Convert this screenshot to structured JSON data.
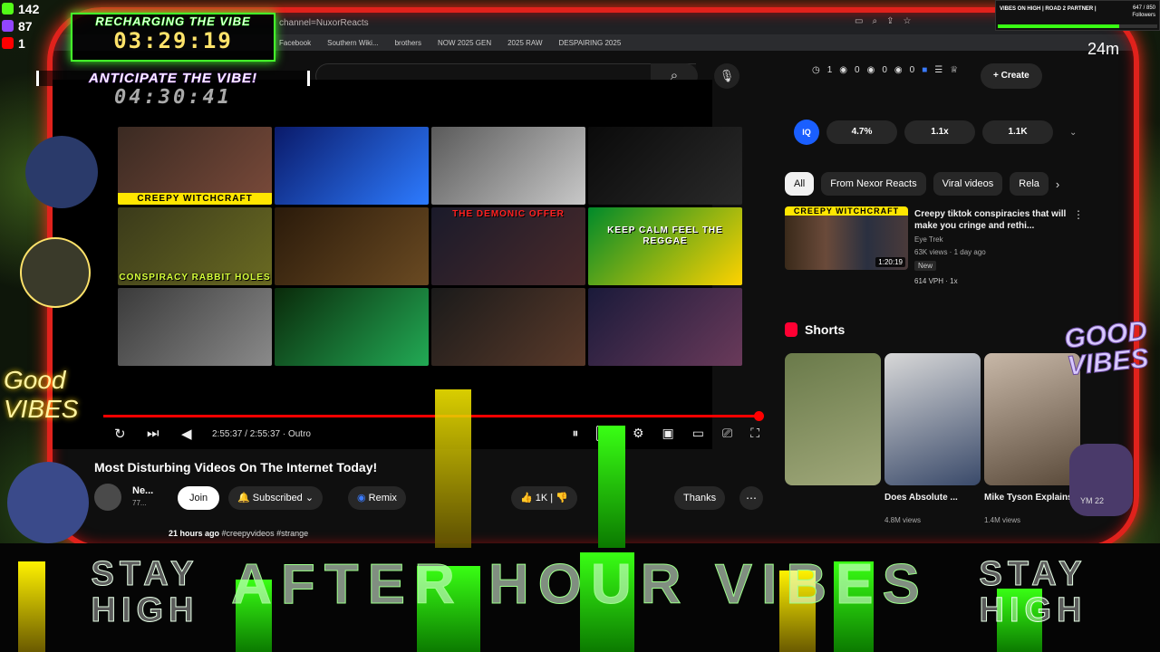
{
  "hud": {
    "kick_count": "142",
    "twitch_count": "87",
    "youtube_count": "1"
  },
  "recharge": {
    "label": "RECHARGING THE VIBE",
    "time": "03:29:19"
  },
  "anticipate": {
    "label": "ANTICIPATE THE VIBE!",
    "time": "04:30:41"
  },
  "goal": {
    "title": "VIBES ON HIGH | ROAD 2 PARTNER |",
    "count": "647 / 850",
    "unit": "Followers",
    "progress": 0.76
  },
  "age_badge": "24m",
  "browser": {
    "address": "channel=NuxorReacts",
    "bookmarks": [
      "Facebook",
      "Southern Wiki...",
      "brothers",
      "NOW 2025 GEN",
      "2025 RAW",
      "DESPAIRING 2025"
    ]
  },
  "topbar": {
    "search_icon": "search-icon",
    "mic_icon": "mic-icon",
    "stats": [
      "1",
      "0",
      "0",
      "0"
    ],
    "create_label": "+ Create"
  },
  "player": {
    "tiles": [
      {
        "caption": "CREEPY WITCHCRAFT",
        "style": "yellow",
        "colors": [
          "#3a2a22",
          "#7a4a3a"
        ]
      },
      {
        "caption": "",
        "style": "",
        "colors": [
          "#0a1a6a",
          "#2d7bff"
        ]
      },
      {
        "caption": "",
        "style": "",
        "colors": [
          "#5a5a5a",
          "#c8c8c8"
        ]
      },
      {
        "caption": "",
        "style": "",
        "colors": [
          "#0a0a0a",
          "#2a2a2a"
        ]
      },
      {
        "caption": "CONSPIRACY RABBIT HOLES",
        "style": "green",
        "colors": [
          "#3a3a1a",
          "#6a6a22"
        ]
      },
      {
        "caption": "",
        "style": "",
        "colors": [
          "#2a1a0a",
          "#6a4a22"
        ]
      },
      {
        "caption": "THE DEMONIC OFFER",
        "style": "red",
        "colors": [
          "#1a1a2a",
          "#4a2a2a"
        ]
      },
      {
        "caption": "KEEP CALM FEEL THE REGGAE",
        "style": "reggae",
        "colors": [
          "#008a2a",
          "#ffd200"
        ]
      },
      {
        "caption": "",
        "style": "",
        "colors": [
          "#3a3a3a",
          "#8a8a8a"
        ]
      },
      {
        "caption": "",
        "style": "",
        "colors": [
          "#0a2a0a",
          "#22aa55"
        ]
      },
      {
        "caption": "",
        "style": "",
        "colors": [
          "#1a1a1a",
          "#5a3a2a"
        ]
      },
      {
        "caption": "",
        "style": "",
        "colors": [
          "#1a1a3a",
          "#6a3a5a"
        ]
      }
    ],
    "time": "2:55:37 / 2:55:37 · Outro",
    "progress": 1.0
  },
  "video": {
    "title": "Most Disturbing Videos On The Internet Today!",
    "channel": "Ne...",
    "subscribers": "77...",
    "join_label": "Join",
    "subscribe_label": "Subscribed",
    "remix_label": "Remix",
    "likes": "1K",
    "thanks_label": "Thanks",
    "age": "21 hours ago",
    "hashtags": "#creepyvideos #strange"
  },
  "sidebar": {
    "iq_label": "IQ",
    "metrics": [
      "4.7%",
      "1.1x",
      "1.1K"
    ],
    "filters": [
      "All",
      "From Nexor Reacts",
      "Viral videos",
      "Rela"
    ],
    "rec": {
      "caption": "CREEPY WITCHCRAFT",
      "duration": "1:20:19",
      "title": "Creepy tiktok conspiracies that will make you cringe and rethi...",
      "channel": "Eye Trek",
      "meta": "63K views · 1 day ago",
      "badge": "New",
      "vph": "614 VPH",
      "multiplier": "1x"
    },
    "shorts_label": "Shorts",
    "shorts": [
      {
        "title": "",
        "views": "",
        "colors": [
          "#6a7a4a",
          "#a0a87a"
        ]
      },
      {
        "title": "Does Absolute ...",
        "views": "4.8M views",
        "colors": [
          "#d8d8d8",
          "#3a4a6a"
        ]
      },
      {
        "title": "Mike Tyson Explains W...",
        "views": "1.4M views",
        "colors": [
          "#c8b8a8",
          "#5a4a3a"
        ]
      }
    ]
  },
  "banner": {
    "main": "AFTER HOUR VIBES",
    "stay_high": "STAY HIGH"
  },
  "stickers": {
    "good_vibes": "GOOD VIBES",
    "good_vibes_left": "Good VIBES",
    "sticker_small": "YM 22"
  }
}
